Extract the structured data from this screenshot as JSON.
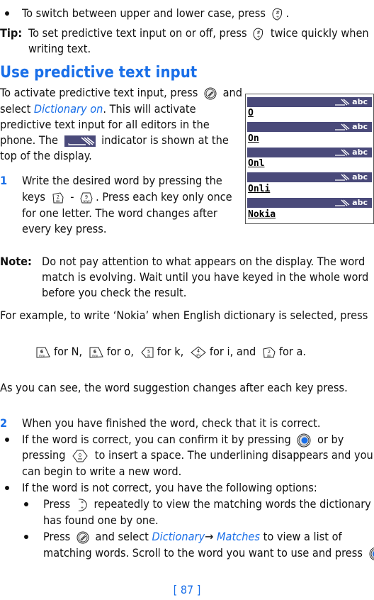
{
  "top": {
    "bullet_text": "To switch between upper and lower case, press",
    "bullet_key": "hash-key",
    "tip_label": "Tip:",
    "tip_line1": "To set predictive text input on or off, press",
    "tip_line1_end": "twice quickly when",
    "tip_line2": "writing text."
  },
  "section": {
    "heading": "Use predictive text input",
    "intro": [
      "To activate predictive text input, press",
      "and",
      "select",
      "Dictionary on",
      ". This will activate",
      "predictive text input for all editors in the",
      "phone. The",
      "indicator is shown at the",
      "top of the display."
    ],
    "step1_num": "1",
    "step1": [
      "Write the desired word by pressing the",
      "keys",
      "-",
      ". Press each key only once",
      "for one letter. The word changes after",
      "every key press."
    ]
  },
  "phone_screen": {
    "indicator_text": "abc",
    "words": [
      "O",
      "On",
      "Onl",
      "Onli",
      "Nokia"
    ]
  },
  "note": {
    "label": "Note:",
    "lines": [
      "Do not pay attention to what appears on the display. The word",
      "match is evolving. Wait until you have keyed in the whole word",
      "before you check the result."
    ]
  },
  "example": {
    "intro": "For example, to write ‘Nokia’ when English dictionary is selected, press",
    "sequence": [
      {
        "key": "6",
        "sub": "mno",
        "text": "for N,"
      },
      {
        "key": "6",
        "sub": "mno",
        "text": "for o,"
      },
      {
        "key": "5",
        "sub": "jkl",
        "text": "for k,"
      },
      {
        "key": "4",
        "sub": "ghi",
        "text": "for i, and"
      },
      {
        "key": "2",
        "sub": "abc",
        "text": "for a."
      }
    ],
    "after": "As you can see, the word suggestion changes after each key press."
  },
  "step2": {
    "num": "2",
    "text": "When you have finished the word, check that it is correct.",
    "b1_line1a": "If the word is correct, you can confirm it by pressing",
    "b1_line1b": "or by",
    "b1_line2a": "pressing",
    "b1_line2b": "to insert a space. The underlining disappears and you",
    "b1_line3": "can begin to write a new word.",
    "b2": "If the word is not correct, you have the following options:",
    "sub1_a": "Press",
    "sub1_b": "repeatedly to view the matching words the dictionary",
    "sub1_line2": "has found one by one.",
    "sub2_a": "Press",
    "sub2_b": "and select",
    "sub2_menu1": "Dictionary",
    "sub2_arrow": "→",
    "sub2_menu2": "Matches",
    "sub2_c": "to view a list of",
    "sub2_line2": "matching words. Scroll to the word you want to use and press"
  },
  "footer": {
    "page": "[ 87 ]"
  },
  "colors": {
    "accent": "#1a6fe8",
    "phone_bar": "#4a4a7a"
  }
}
